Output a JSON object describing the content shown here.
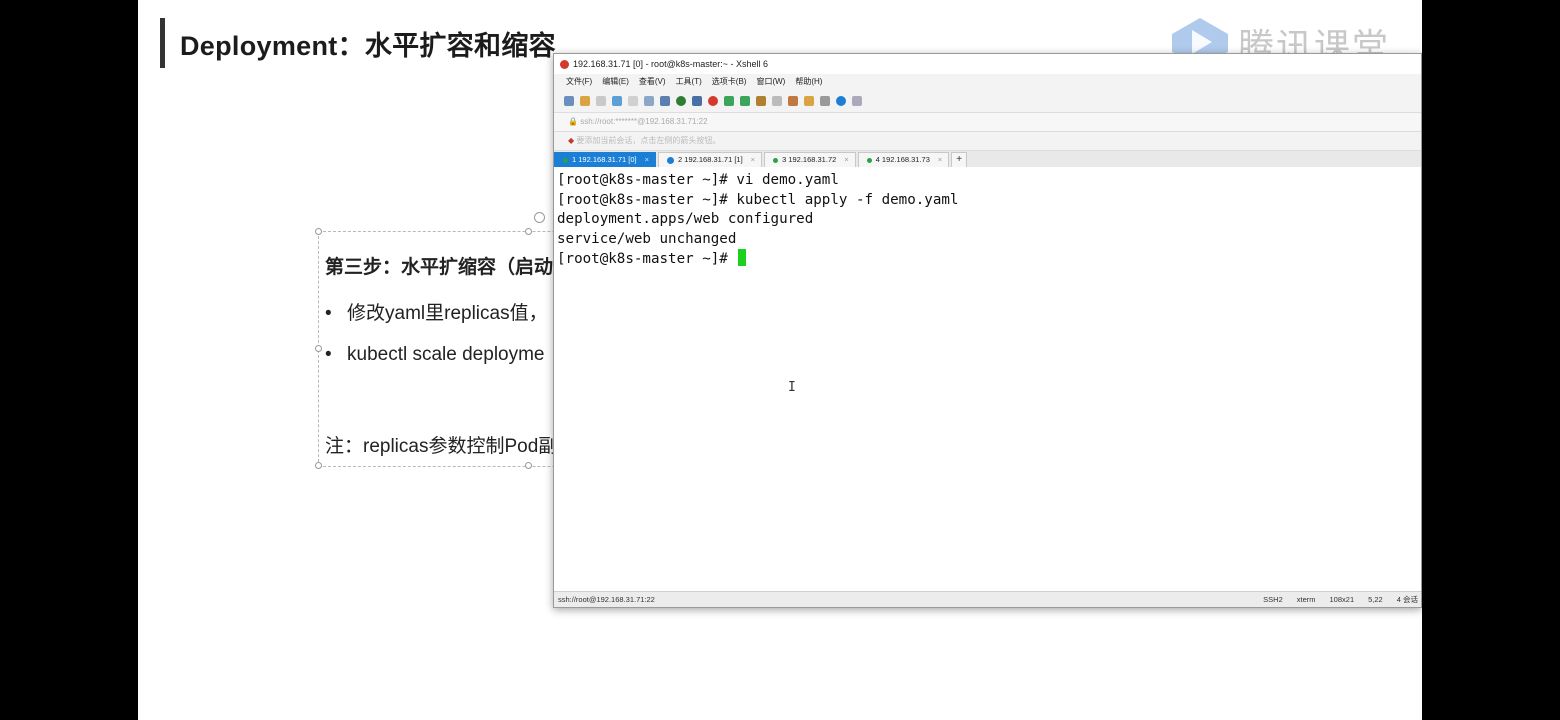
{
  "slide": {
    "title": "Deployment：水平扩容和缩容",
    "watermark": "腾讯课堂",
    "textbox": {
      "step": "第三步：水平扩缩容（启动多",
      "bullet1": "修改yaml里replicas值，",
      "bullet2": "kubectl scale deployme",
      "bullet_symbol": "•",
      "note": "注：replicas参数控制Pod副"
    }
  },
  "xshell": {
    "title": "192.168.31.71 [0] - root@k8s-master:~ - Xshell 6",
    "menu": [
      "文件(F)",
      "编辑(E)",
      "查看(V)",
      "工具(T)",
      "选项卡(B)",
      "窗口(W)",
      "帮助(H)"
    ],
    "address": "ssh://root:*******@192.168.31.71:22",
    "tip": "要添加当前会话，点击左侧的箭头按钮。",
    "tabs": [
      {
        "label": "1 192.168.31.71 [0]",
        "active": true
      },
      {
        "label": "2 192.168.31.71 [1]",
        "active": false
      },
      {
        "label": "3 192.168.31.72",
        "active": false
      },
      {
        "label": "4 192.168.31.73",
        "active": false
      }
    ],
    "tab_add": "+",
    "terminal_lines": [
      "[root@k8s-master ~]# vi demo.yaml",
      "[root@k8s-master ~]# kubectl apply -f demo.yaml",
      "deployment.apps/web configured",
      "service/web unchanged",
      "[root@k8s-master ~]# "
    ],
    "status": {
      "left": "ssh://root@192.168.31.71:22",
      "protocol": "SSH2",
      "term": "xterm",
      "size": "108x21",
      "cursor_pos": "5,22",
      "sessions": "4 会话"
    }
  },
  "colors": {
    "tab_active": "#1b7fd6",
    "cursor": "#1fd11f",
    "connected_dot": "#29a345"
  }
}
